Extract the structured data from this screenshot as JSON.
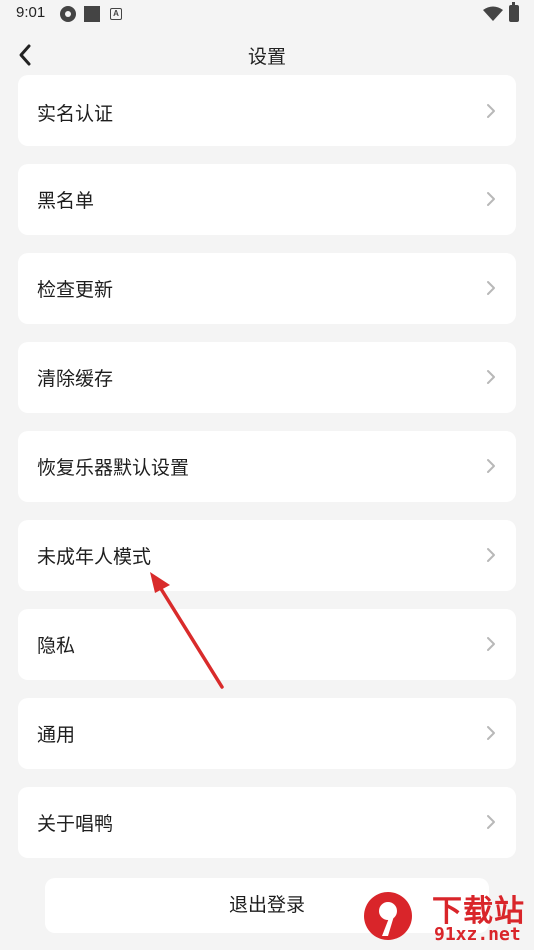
{
  "status_bar": {
    "time": "9:01",
    "notification_icons": [
      "pinwheel-icon",
      "square-icon",
      "a-box-icon"
    ],
    "wifi_icon": "wifi-icon",
    "battery_icon": "battery-icon"
  },
  "header": {
    "back_icon": "chevron-left-icon",
    "title": "设置"
  },
  "menu": {
    "items": [
      {
        "label": "实名认证"
      },
      {
        "label": "黑名单"
      },
      {
        "label": "检查更新"
      },
      {
        "label": "清除缓存"
      },
      {
        "label": "恢复乐器默认设置"
      },
      {
        "label": "未成年人模式"
      },
      {
        "label": "隐私"
      },
      {
        "label": "通用"
      },
      {
        "label": "关于唱鸭"
      }
    ],
    "chevron_icon": "chevron-right-icon"
  },
  "logout": {
    "label": "退出登录"
  },
  "annotation": {
    "arrow_color": "#d92b2b",
    "points_to": "未成年人模式"
  },
  "watermark": {
    "cn_text": "下载站",
    "en_text": "91xz.net",
    "logo_text": "9",
    "color": "#d9252a"
  },
  "colors": {
    "background": "#f4f4f4",
    "card": "#ffffff",
    "text": "#1e1e1e",
    "chevron": "#b8b8b8"
  }
}
